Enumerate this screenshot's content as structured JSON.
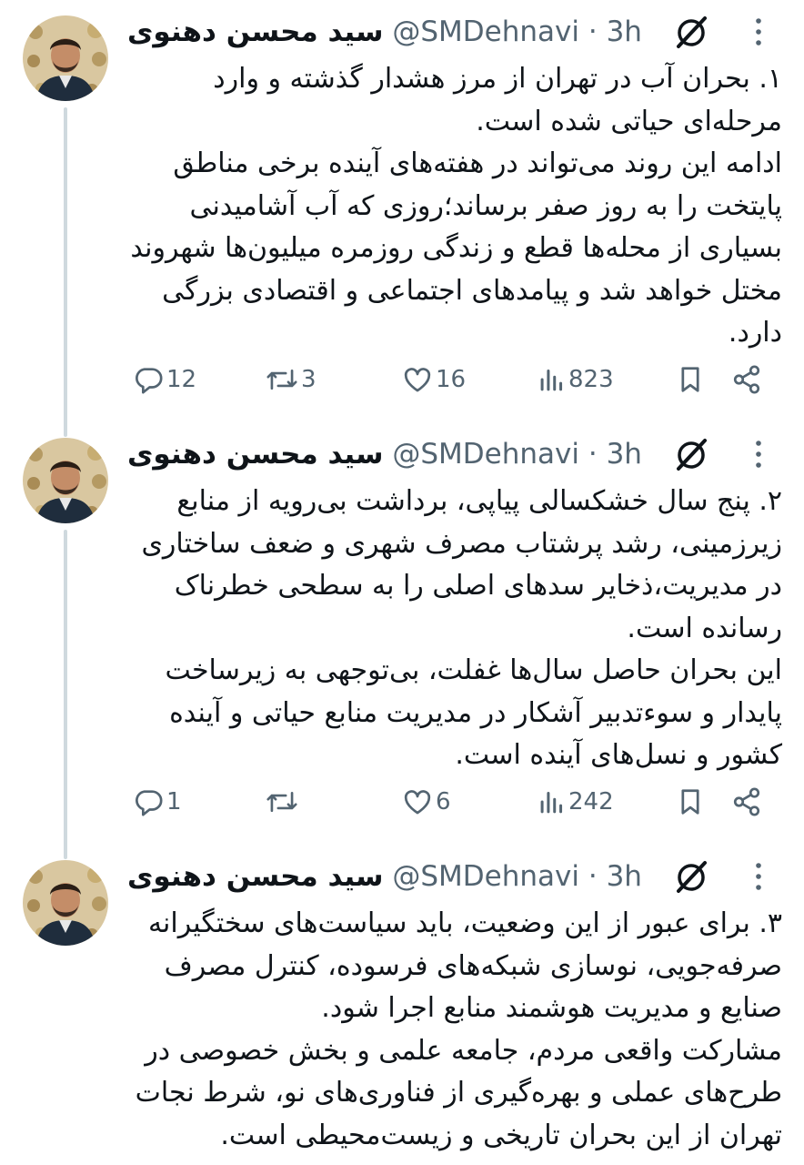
{
  "tweets": [
    {
      "author": {
        "display_name": "سید محسن دهنوی",
        "handle": "@SMDehnavi",
        "time": "3h"
      },
      "paragraphs": [
        "۱. بحران آب در تهران از مرز هشدار گذشته و وارد مرحله‌ای حیاتی شده است.",
        "ادامه این روند می‌تواند در هفته‌های آینده برخی مناطق پایتخت را به روز صفر برساند؛روزی که آب آشامیدنی بسیاری از محله‌ها قطع و زندگی روزمره میلیون‌ها شهروند مختل خواهد شد و پیامدهای اجتماعی و اقتصادی بزرگی دارد."
      ],
      "stats": {
        "replies": "12",
        "retweets": "3",
        "likes": "16",
        "views": "823"
      }
    },
    {
      "author": {
        "display_name": "سید محسن دهنوی",
        "handle": "@SMDehnavi",
        "time": "3h"
      },
      "paragraphs": [
        "۲. پنج سال خشکسالی پیاپی، برداشت بی‌رویه از منابع زیرزمینی، رشد پرشتاب مصرف شهری و ضعف ساختاری در مدیریت،ذخایر سدهای اصلی را به سطحی خطرناک رسانده است.",
        "این بحران حاصل سال‌ها غفلت، بی‌توجهی به زیرساخت پایدار و سوءتدبیر آشکار در مدیریت منابع حیاتی و آینده کشور و نسل‌های آینده است."
      ],
      "stats": {
        "replies": "1",
        "retweets": "",
        "likes": "6",
        "views": "242"
      }
    },
    {
      "author": {
        "display_name": "سید محسن دهنوی",
        "handle": "@SMDehnavi",
        "time": "3h"
      },
      "paragraphs": [
        "۳. برای عبور از این وضعیت، باید سیاست‌های سختگیرانه صرفه‌جویی، نوسازی شبکه‌های فرسوده، کنترل مصرف صنایع و مدیریت هوشمند منابع اجرا شود.",
        "مشارکت واقعی مردم، جامعه علمی و بخش خصوصی در طرح‌های عملی و بهره‌گیری از فناوری‌های نو، شرط نجات تهران از این بحران تاریخی و زیست‌محیطی است."
      ],
      "stats": {
        "replies": "",
        "retweets": "",
        "likes": "",
        "views": ""
      }
    }
  ],
  "icons": {
    "reply": "reply-icon",
    "retweet": "retweet-icon",
    "like": "heart-icon",
    "views": "views-icon",
    "bookmark": "bookmark-icon",
    "share": "share-icon",
    "grok": "grok-icon",
    "more": "more-dots-icon"
  },
  "colors": {
    "text": "#0f1419",
    "muted": "#536471",
    "thread_line": "#cfd9de",
    "background": "#ffffff"
  }
}
